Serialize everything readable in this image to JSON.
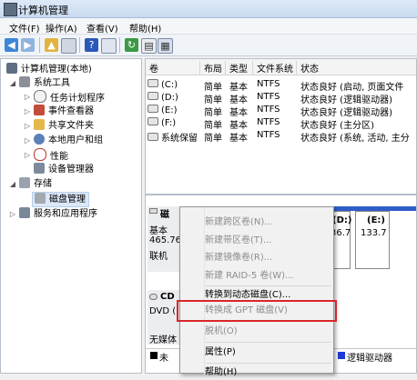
{
  "window": {
    "title": "计算机管理"
  },
  "menubar": [
    "文件(F)",
    "操作(A)",
    "查看(V)",
    "帮助(H)"
  ],
  "tree": {
    "root": "计算机管理(本地)",
    "system_tools": "系统工具",
    "task_scheduler": "任务计划程序",
    "event_viewer": "事件查看器",
    "shared_folders": "共享文件夹",
    "local_users": "本地用户和组",
    "performance": "性能",
    "device_manager": "设备管理器",
    "storage": "存储",
    "disk_management": "磁盘管理",
    "services": "服务和应用程序"
  },
  "volumes": {
    "headers": [
      "卷",
      "布局",
      "类型",
      "文件系统",
      "状态"
    ],
    "rows": [
      [
        "(C:)",
        "简单",
        "基本",
        "NTFS",
        "状态良好 (启动, 页面文件"
      ],
      [
        "(D:)",
        "简单",
        "基本",
        "NTFS",
        "状态良好 (逻辑驱动器)"
      ],
      [
        "(E:)",
        "简单",
        "基本",
        "NTFS",
        "状态良好 (逻辑驱动器)"
      ],
      [
        "(F:)",
        "简单",
        "基本",
        "NTFS",
        "状态良好 (主分区)"
      ],
      [
        "系统保留",
        "简单",
        "基本",
        "NTFS",
        "状态良好 (系统, 活动, 主分"
      ]
    ]
  },
  "disk0": {
    "label": "磁",
    "type": "基本",
    "size": "465.76",
    "status": "联机"
  },
  "disk0_parts": [
    {
      "letter": "(D:)",
      "size": "36.7"
    },
    {
      "letter": "(E:)",
      "size": "133.7"
    }
  ],
  "cdrom": {
    "label": "CD",
    "drive": "DVD (",
    "media": "无媒体"
  },
  "legend": {
    "unallocated": "未",
    "logical": "逻辑驱动器"
  },
  "context_menu": {
    "new_spanned": "新建跨区卷(N)...",
    "new_striped": "新建带区卷(T)...",
    "new_mirrored": "新建镜像卷(R)...",
    "new_raid5": "新建 RAID-5 卷(W)...",
    "to_dynamic": "转换到动态磁盘(C)...",
    "to_gpt": "转换成 GPT 磁盘(V)",
    "offline": "脱机(O)",
    "properties": "属性(P)",
    "help": "帮助(H)"
  },
  "colors": {
    "highlight_box": "#d9262b",
    "partition_blue": "#2f5dc8",
    "legend_black": "#000000"
  }
}
